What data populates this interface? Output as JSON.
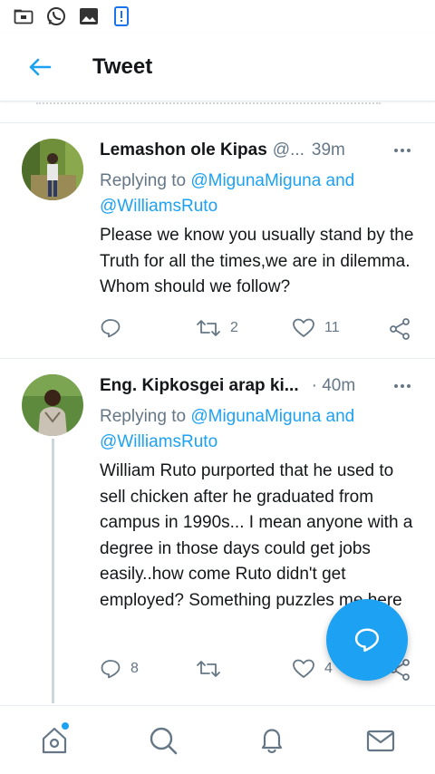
{
  "header": {
    "title": "Tweet"
  },
  "tweets": [
    {
      "name": "Lemashon ole Kipas",
      "handle": "@...",
      "time": "39m",
      "replying_prefix": "Replying to",
      "mention1": "@MigunaMiguna",
      "and": "and",
      "mention2": "@WilliamsRuto",
      "text": "Please we know you usually stand by the Truth for all the times,we are in dilemma. Whom should we follow?",
      "reply_count": "",
      "retweet_count": "2",
      "like_count": "11"
    },
    {
      "name": "Eng. Kipkosgei arap ki...",
      "handle": "",
      "time": "· 40m",
      "replying_prefix": "Replying to",
      "mention1": "@MigunaMiguna",
      "and": "and",
      "mention2": "@WilliamsRuto",
      "text": "William Ruto purported that he used to sell chicken after he graduated from campus in 1990s... I mean anyone with a degree in those days could get jobs easily..how come Ruto didn't get employed? Something puzzles me here",
      "reply_count": "8",
      "retweet_count": "",
      "like_count": "4"
    }
  ],
  "colors": {
    "accent": "#1da1f2",
    "muted": "#657786",
    "text": "#14171a"
  }
}
